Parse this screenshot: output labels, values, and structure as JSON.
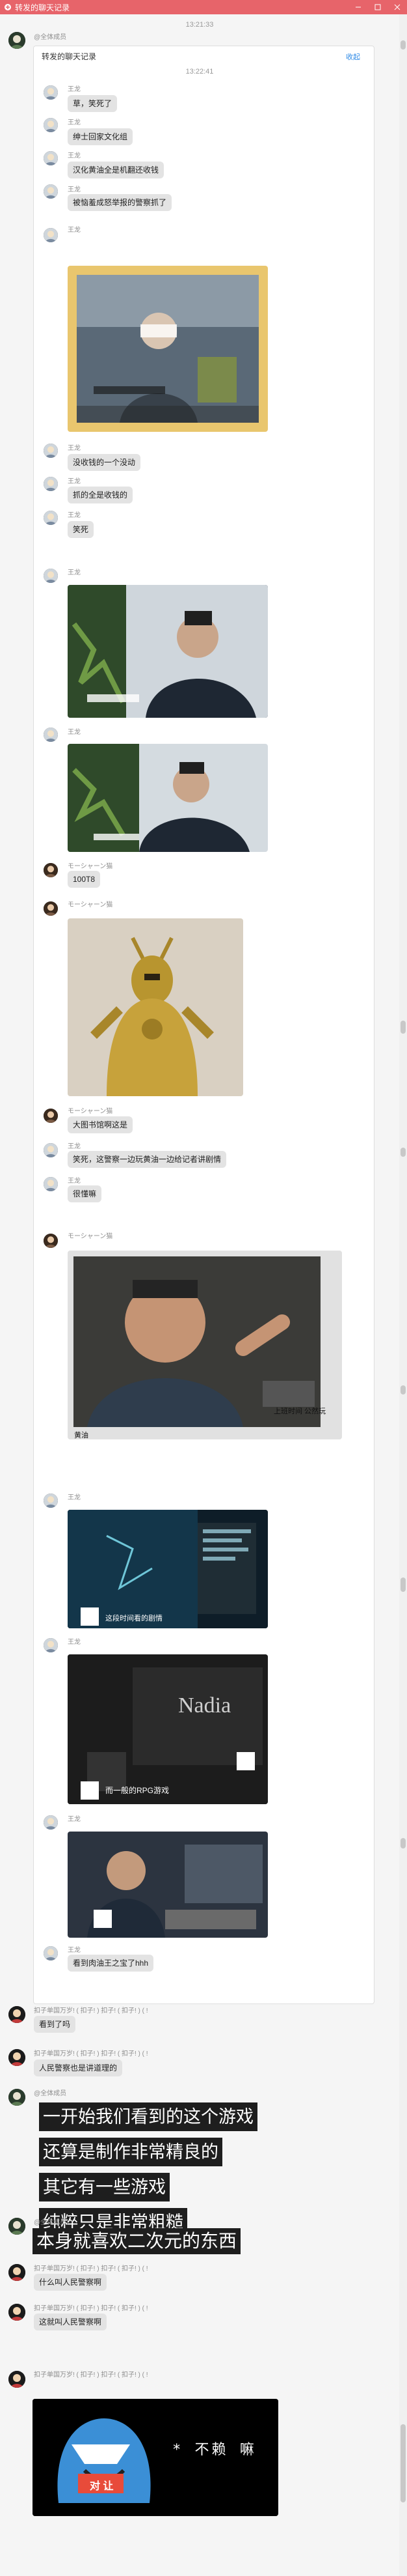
{
  "window": {
    "title": "转发的聊天记录",
    "accent": "#e7646a"
  },
  "outer_timestamp": "13:21:33",
  "card": {
    "sender": "@全体成员",
    "title": "转发的聊天记录",
    "action": "收起",
    "timestamp": "13:22:41",
    "messages": [
      {
        "sender": "王龙",
        "text": "草，笑死了"
      },
      {
        "sender": "王龙",
        "text": "绅士回家文化组"
      },
      {
        "sender": "王龙",
        "text": "汉化黄油全是机翻还收钱"
      },
      {
        "sender": "王龙",
        "text": "被恼羞成怒举报的警察抓了"
      },
      {
        "sender": "王龙",
        "image_caption": ""
      },
      {
        "sender": "王龙",
        "text": "没收钱的一个没动"
      },
      {
        "sender": "王龙",
        "text": "抓的全是收钱的"
      },
      {
        "sender": "王龙",
        "text": "笑死"
      },
      {
        "sender": "王龙"
      },
      {
        "sender": "王龙"
      },
      {
        "sender": "モーシャーン猫",
        "text": "100T8"
      },
      {
        "sender": "モーシャーン猫"
      },
      {
        "sender": "モーシャーン猫",
        "text": "大图书馆啊这是"
      },
      {
        "sender": "王龙",
        "text": "笑死，这警察一边玩黄油一边给记者讲剧情"
      },
      {
        "sender": "王龙",
        "text": "很懂嘛"
      },
      {
        "sender": "モーシャーン猫",
        "image_caption": "上班时间 公然玩",
        "image_caption2": "黄油"
      },
      {
        "sender": "王龙",
        "image_caption": "这段时间看的剧情"
      },
      {
        "sender": "王龙",
        "image_caption": "而一般的RPG游戏",
        "image_title": "Nadia"
      },
      {
        "sender": "王龙"
      },
      {
        "sender": "王龙",
        "text": "看到肉油王之宝了hhh"
      }
    ]
  },
  "messages": [
    {
      "sender": "扣子单国万岁! ( 扣子! ) 扣子! ( 扣子! ) ( !",
      "text": "看到了吗"
    },
    {
      "sender": "扣子单国万岁! ( 扣子! ) 扣子! ( 扣子! ) ( !",
      "text": "人民警察也是讲道理的"
    },
    {
      "sender": "@全体成员",
      "lines": [
        "一开始我们看到的这个游戏",
        "还算是制作非常精良的",
        "其它有一些游戏",
        "纯粹只是非常粗糙"
      ]
    },
    {
      "sender": "@全体成员",
      "text": "本身就喜欢二次元的东西"
    },
    {
      "sender": "扣子单国万岁! ( 扣子! ) 扣子! ( 扣子! ) ( !",
      "text": "什么叫人民警察啊"
    },
    {
      "sender": "扣子单国万岁! ( 扣子! ) 扣子! ( 扣子! ) ( !",
      "text": "这就叫人民警察啊"
    },
    {
      "sender": "扣子单国万岁! ( 扣子! ) 扣子! ( 扣子! ) ( !",
      "sticker_text": "* 不赖 嘛",
      "sticker_badge": "对 让"
    }
  ]
}
